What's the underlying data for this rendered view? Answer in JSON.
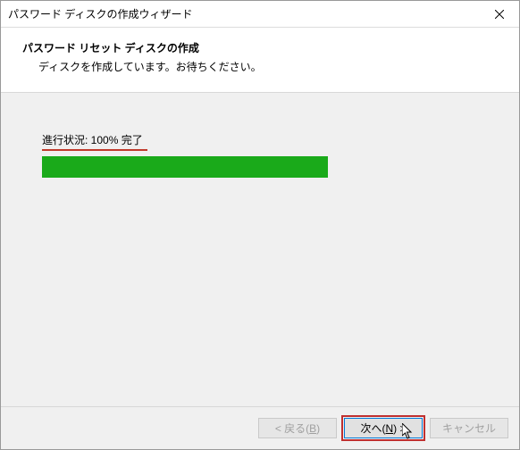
{
  "window": {
    "title": "パスワード ディスクの作成ウィザード"
  },
  "header": {
    "title": "パスワード リセット ディスクの作成",
    "subtitle": "ディスクを作成しています。お待ちください。"
  },
  "progress": {
    "label": "進行状況: 100% 完了",
    "percent": 100
  },
  "buttons": {
    "back_prefix": "< 戻る(",
    "back_key": "B",
    "back_suffix": ")",
    "next_prefix": "次へ(",
    "next_key": "N",
    "next_suffix": ") >",
    "cancel": "キャンセル"
  },
  "colors": {
    "progress_fill": "#1aaa1a",
    "highlight_outline": "#c03030",
    "focus_border": "#0078d7"
  }
}
